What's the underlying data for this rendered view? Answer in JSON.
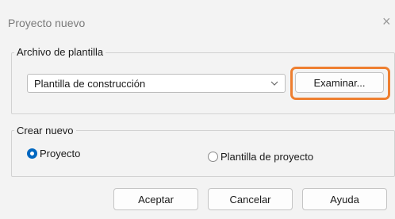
{
  "window": {
    "title": "Proyecto nuevo",
    "close_glyph": "×"
  },
  "template_group": {
    "legend": "Archivo de plantilla",
    "select_value": "Plantilla de construcción",
    "browse_button": "Examinar..."
  },
  "create_group": {
    "legend": "Crear nuevo",
    "options": [
      {
        "label": "Proyecto",
        "checked": true
      },
      {
        "label": "Plantilla de proyecto",
        "checked": false
      }
    ]
  },
  "footer": {
    "ok_label": "Aceptar",
    "cancel_label": "Cancelar",
    "help_label": "Ayuda"
  },
  "colors": {
    "focus_ring": "#ee7f30",
    "radio_checked": "#0067c0"
  },
  "icons": {
    "dropdown": "chevron-down-icon",
    "close": "close-icon"
  }
}
